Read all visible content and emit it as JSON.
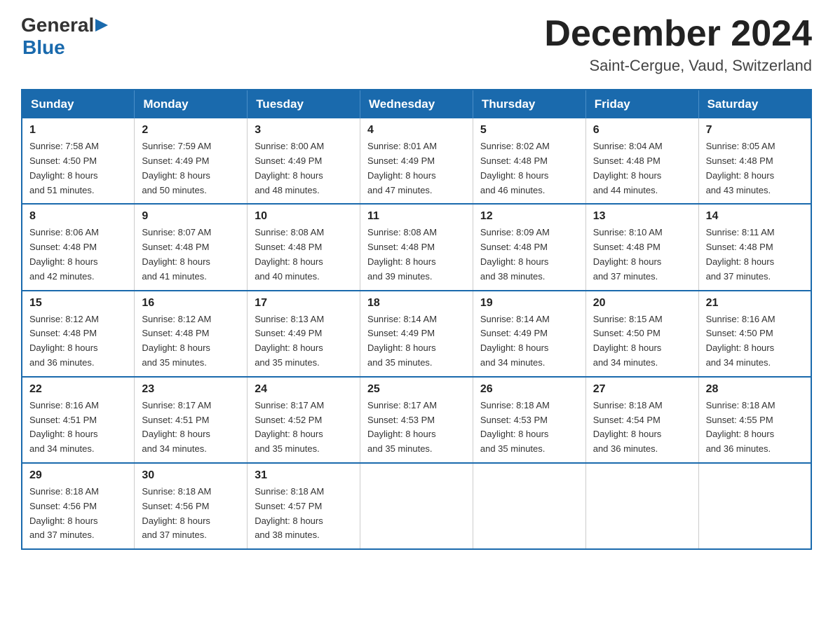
{
  "header": {
    "logo": {
      "general": "General",
      "blue": "Blue",
      "arrow": "▶"
    },
    "title": "December 2024",
    "location": "Saint-Cergue, Vaud, Switzerland"
  },
  "days_of_week": [
    "Sunday",
    "Monday",
    "Tuesday",
    "Wednesday",
    "Thursday",
    "Friday",
    "Saturday"
  ],
  "weeks": [
    [
      {
        "day": "1",
        "sunrise": "7:58 AM",
        "sunset": "4:50 PM",
        "daylight": "8 hours and 51 minutes."
      },
      {
        "day": "2",
        "sunrise": "7:59 AM",
        "sunset": "4:49 PM",
        "daylight": "8 hours and 50 minutes."
      },
      {
        "day": "3",
        "sunrise": "8:00 AM",
        "sunset": "4:49 PM",
        "daylight": "8 hours and 48 minutes."
      },
      {
        "day": "4",
        "sunrise": "8:01 AM",
        "sunset": "4:49 PM",
        "daylight": "8 hours and 47 minutes."
      },
      {
        "day": "5",
        "sunrise": "8:02 AM",
        "sunset": "4:48 PM",
        "daylight": "8 hours and 46 minutes."
      },
      {
        "day": "6",
        "sunrise": "8:04 AM",
        "sunset": "4:48 PM",
        "daylight": "8 hours and 44 minutes."
      },
      {
        "day": "7",
        "sunrise": "8:05 AM",
        "sunset": "4:48 PM",
        "daylight": "8 hours and 43 minutes."
      }
    ],
    [
      {
        "day": "8",
        "sunrise": "8:06 AM",
        "sunset": "4:48 PM",
        "daylight": "8 hours and 42 minutes."
      },
      {
        "day": "9",
        "sunrise": "8:07 AM",
        "sunset": "4:48 PM",
        "daylight": "8 hours and 41 minutes."
      },
      {
        "day": "10",
        "sunrise": "8:08 AM",
        "sunset": "4:48 PM",
        "daylight": "8 hours and 40 minutes."
      },
      {
        "day": "11",
        "sunrise": "8:08 AM",
        "sunset": "4:48 PM",
        "daylight": "8 hours and 39 minutes."
      },
      {
        "day": "12",
        "sunrise": "8:09 AM",
        "sunset": "4:48 PM",
        "daylight": "8 hours and 38 minutes."
      },
      {
        "day": "13",
        "sunrise": "8:10 AM",
        "sunset": "4:48 PM",
        "daylight": "8 hours and 37 minutes."
      },
      {
        "day": "14",
        "sunrise": "8:11 AM",
        "sunset": "4:48 PM",
        "daylight": "8 hours and 37 minutes."
      }
    ],
    [
      {
        "day": "15",
        "sunrise": "8:12 AM",
        "sunset": "4:48 PM",
        "daylight": "8 hours and 36 minutes."
      },
      {
        "day": "16",
        "sunrise": "8:12 AM",
        "sunset": "4:48 PM",
        "daylight": "8 hours and 35 minutes."
      },
      {
        "day": "17",
        "sunrise": "8:13 AM",
        "sunset": "4:49 PM",
        "daylight": "8 hours and 35 minutes."
      },
      {
        "day": "18",
        "sunrise": "8:14 AM",
        "sunset": "4:49 PM",
        "daylight": "8 hours and 35 minutes."
      },
      {
        "day": "19",
        "sunrise": "8:14 AM",
        "sunset": "4:49 PM",
        "daylight": "8 hours and 34 minutes."
      },
      {
        "day": "20",
        "sunrise": "8:15 AM",
        "sunset": "4:50 PM",
        "daylight": "8 hours and 34 minutes."
      },
      {
        "day": "21",
        "sunrise": "8:16 AM",
        "sunset": "4:50 PM",
        "daylight": "8 hours and 34 minutes."
      }
    ],
    [
      {
        "day": "22",
        "sunrise": "8:16 AM",
        "sunset": "4:51 PM",
        "daylight": "8 hours and 34 minutes."
      },
      {
        "day": "23",
        "sunrise": "8:17 AM",
        "sunset": "4:51 PM",
        "daylight": "8 hours and 34 minutes."
      },
      {
        "day": "24",
        "sunrise": "8:17 AM",
        "sunset": "4:52 PM",
        "daylight": "8 hours and 35 minutes."
      },
      {
        "day": "25",
        "sunrise": "8:17 AM",
        "sunset": "4:53 PM",
        "daylight": "8 hours and 35 minutes."
      },
      {
        "day": "26",
        "sunrise": "8:18 AM",
        "sunset": "4:53 PM",
        "daylight": "8 hours and 35 minutes."
      },
      {
        "day": "27",
        "sunrise": "8:18 AM",
        "sunset": "4:54 PM",
        "daylight": "8 hours and 36 minutes."
      },
      {
        "day": "28",
        "sunrise": "8:18 AM",
        "sunset": "4:55 PM",
        "daylight": "8 hours and 36 minutes."
      }
    ],
    [
      {
        "day": "29",
        "sunrise": "8:18 AM",
        "sunset": "4:56 PM",
        "daylight": "8 hours and 37 minutes."
      },
      {
        "day": "30",
        "sunrise": "8:18 AM",
        "sunset": "4:56 PM",
        "daylight": "8 hours and 37 minutes."
      },
      {
        "day": "31",
        "sunrise": "8:18 AM",
        "sunset": "4:57 PM",
        "daylight": "8 hours and 38 minutes."
      },
      null,
      null,
      null,
      null
    ]
  ],
  "labels": {
    "sunrise": "Sunrise:",
    "sunset": "Sunset:",
    "daylight": "Daylight:"
  }
}
